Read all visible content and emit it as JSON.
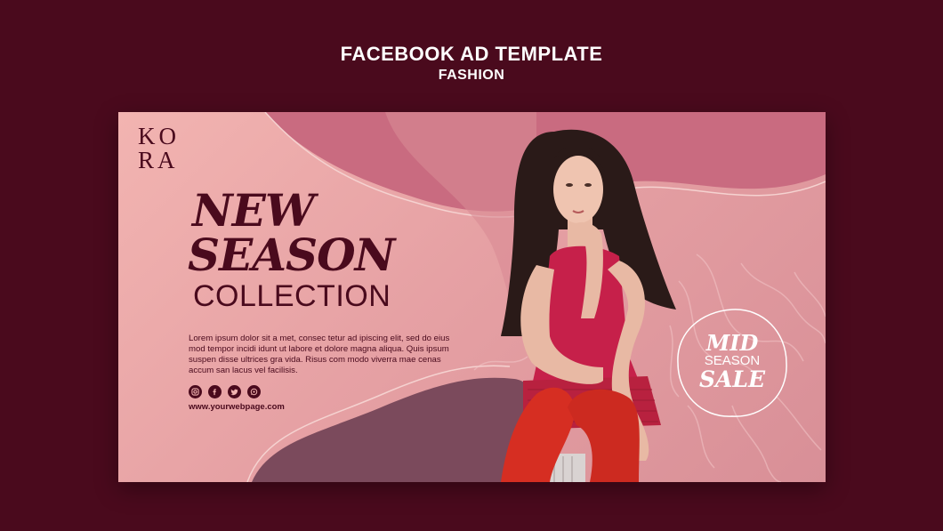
{
  "header": {
    "title": "FACEBOOK AD TEMPLATE",
    "subtitle": "FASHION"
  },
  "ad": {
    "logo": {
      "line1": "KO",
      "line2": "RA"
    },
    "headline": {
      "line1": "NEW",
      "line2": "SEASON"
    },
    "collection": "COLLECTION",
    "body": "Lorem ipsum dolor sit a met, consec tetur ad ipiscing elit, sed do eius mod tempor incidi idunt ut labore et dolore magna aliqua. Quis ipsum suspen disse ultrices gra vida. Risus com modo viverra mae cenas accum san lacus vel facilisis.",
    "socials": [
      "instagram-icon",
      "facebook-icon",
      "twitter-icon",
      "whatsapp-icon"
    ],
    "url": "www.yourwebpage.com",
    "sale": {
      "line1": "MID",
      "line2": "SEASON",
      "line3": "SALE"
    }
  },
  "colors": {
    "background": "#4a0a1d",
    "banner_pink": "#f2b4b1",
    "blob_dark_pink": "#c96b80",
    "blob_plum": "#7b4a5c",
    "dress": "#c6204a",
    "tights": "#d62e22"
  }
}
